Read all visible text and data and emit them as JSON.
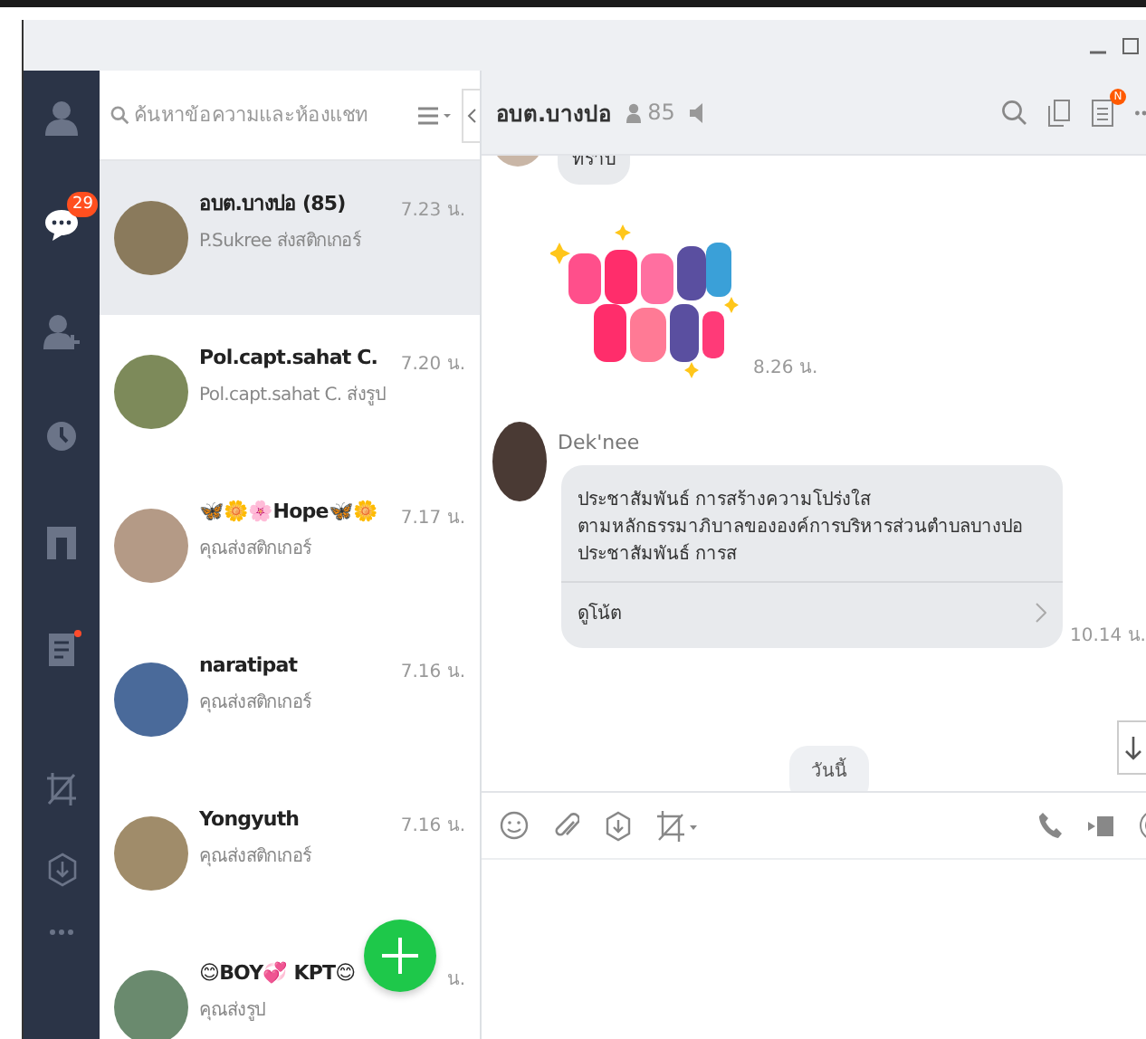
{
  "nav_items": [
    {
      "kind": "friends",
      "selected": false
    },
    {
      "kind": "chats",
      "selected": true,
      "badge": "29"
    },
    {
      "kind": "add-friend",
      "selected": false
    },
    {
      "kind": "timeline",
      "selected": false
    },
    {
      "kind": "keep",
      "selected": false
    },
    {
      "kind": "notes",
      "selected": false,
      "dot": true
    },
    {
      "kind": "crop",
      "selected": false
    },
    {
      "kind": "download",
      "selected": false
    },
    {
      "kind": "more",
      "selected": false
    }
  ],
  "search": {
    "placeholder": "ค้นหาข้อความและห้องแชท"
  },
  "chats": [
    {
      "name": "อบต.บางปอ (85)",
      "preview": "P.Sukree ส่งสติกเกอร์",
      "time": "7.23 น.",
      "selected": true,
      "color": "#8a7a5c"
    },
    {
      "name": "Pol.capt.sahat C.",
      "preview": "Pol.capt.sahat C. ส่งรูป",
      "time": "7.20 น.",
      "selected": false,
      "color": "#7d8a5a"
    },
    {
      "name": "🦋🌼🌸Hope🦋🌼",
      "preview": "คุณส่งสติกเกอร์",
      "time": "7.17 น.",
      "selected": false,
      "color": "#b49a86"
    },
    {
      "name": "naratipat",
      "preview": "คุณส่งสติกเกอร์",
      "time": "7.16 น.",
      "selected": false,
      "color": "#4a6a9a"
    },
    {
      "name": "Yongyuth",
      "preview": "คุณส่งสติกเกอร์",
      "time": "7.16 น.",
      "selected": false,
      "color": "#a08c6a"
    },
    {
      "name": "😊BOY💞 KPT😊",
      "preview": "คุณส่งรูป",
      "time": "น.",
      "selected": false,
      "color": "#6a8a6e"
    }
  ],
  "header": {
    "title": "อบต.บางปอ",
    "members": "85",
    "badge": "N"
  },
  "messages": [
    {
      "kind": "text",
      "text": "ทราบ"
    },
    {
      "kind": "sticker",
      "time": "8.26 น."
    },
    {
      "kind": "note",
      "sender": "Dek'nee",
      "text": "ประชาสัมพันธ์ การสร้างความโปร่งใส\nตามหลักธรรมาภิบาลขององค์การบริหารส่วนตำบลบางปอ\n ประชาสัมพันธ์ การส",
      "link": "ดูโน้ต",
      "time": "10.14 น."
    }
  ],
  "date_label": "วันนี้"
}
